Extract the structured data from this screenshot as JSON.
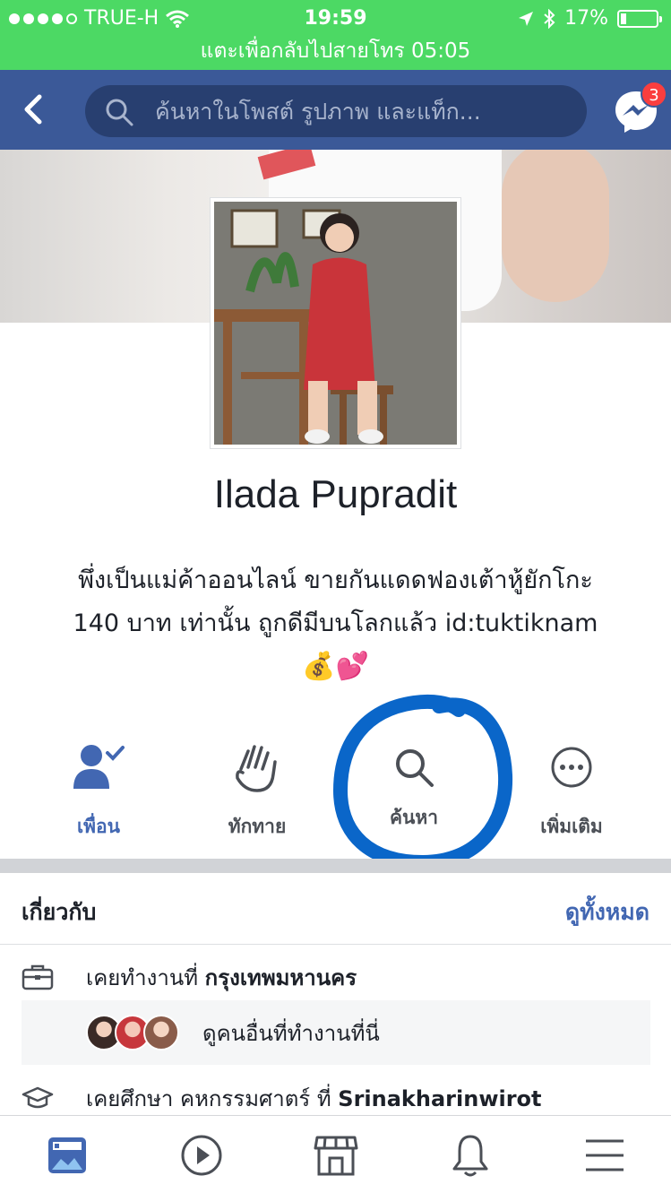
{
  "status_bar": {
    "carrier": "TRUE-H",
    "time": "19:59",
    "battery": "17%",
    "battery_level": 0.17
  },
  "call_banner": {
    "text": "แตะเพื่อกลับไปสายโทร 05:05"
  },
  "header": {
    "search_placeholder": "ค้นหาในโพสต์ รูปภาพ และแท็ก...",
    "messenger_badge": "3",
    "bar_color": "#3b5998"
  },
  "profile": {
    "name": "Ilada Pupradit",
    "bio_line1": "พึ่งเป็นแม่ค้าออนไลน์ ขายกันแดดฟองเต้าหู้ยักโกะ",
    "bio_line2": "140 บาท เท่านั้น ถูกดีมีบนโลกแล้ว id:tuktiknam",
    "bio_emoji": "💰💕"
  },
  "actions": {
    "friends": "เพื่อน",
    "wave": "ทักทาย",
    "search": "ค้นหา",
    "more": "เพิ่มเติม",
    "active_color": "#4267b2"
  },
  "about": {
    "title": "เกี่ยวกับ",
    "see_all": "ดูทั้งหมด",
    "work_prefix": "เคยทำงานที่ ",
    "work_place": "กรุงเทพมหานคร",
    "coworkers_text": "ดูคนอื่นที่ทำงานที่นี่",
    "edu_prefix": "เคยศึกษา คหกรรมศาตร์ ที่ ",
    "edu_place": "Srinakharinwirot"
  },
  "tabbar": {
    "items": [
      "news-feed-icon",
      "watch-icon",
      "marketplace-icon",
      "notifications-icon",
      "menu-icon"
    ]
  }
}
